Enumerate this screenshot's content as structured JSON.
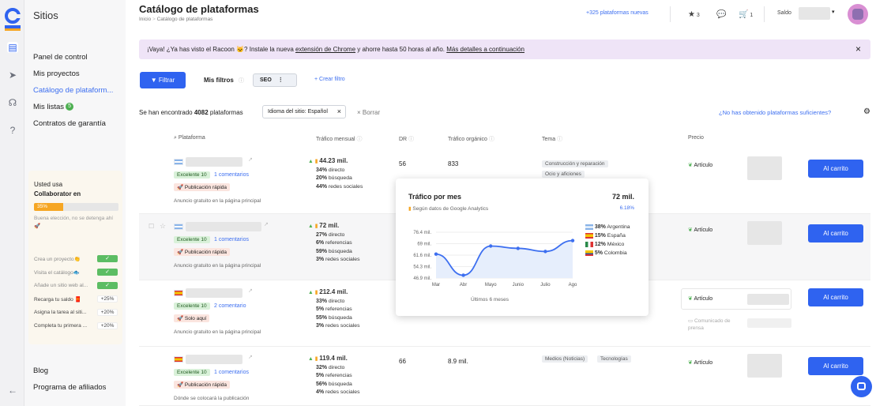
{
  "sidebar": {
    "title": "Sitios",
    "items": [
      "Panel de control",
      "Mis proyectos",
      "Catálogo de plataform...",
      "Mis listas",
      "Contratos de garantía"
    ],
    "lists_badge": "5",
    "footer": [
      "Blog",
      "Programa de afiliados"
    ]
  },
  "promo": {
    "line1": "Usted usa",
    "line2": "Collaborator en",
    "progress": "35%",
    "progress_value": 0.35,
    "note": "Buena elección, no se detenga ahí 🚀",
    "tasks": [
      {
        "label": "Crea un proyecto👏",
        "state": "✓",
        "done": true
      },
      {
        "label": "Visita el catálogo🐟",
        "state": "✓",
        "done": true
      },
      {
        "label": "Añade un sitio web al...",
        "state": "✓",
        "done": true
      },
      {
        "label": "Recarga tu saldo 🧧",
        "state": "+25%",
        "done": false
      },
      {
        "label": "Asigna la tarea al siti...",
        "state": "+20%",
        "done": false
      },
      {
        "label": "Completa tu primera ...",
        "state": "+20%",
        "done": false
      }
    ]
  },
  "header": {
    "title": "Catálogo de plataformas",
    "crumb_home": "Inicio",
    "crumb_sep": ">",
    "crumb_current": "Catálogo de plataformas",
    "new_platforms": "+325 plataformas nuevas",
    "favorites": "3",
    "cart_count": "1",
    "balance_label": "Saldo"
  },
  "banner": {
    "p1": "¡Vaya! ¿Ya has visto el Racoon 🐱? Instale la nueva ",
    "link1": "extensión de Chrome",
    "p2": " y ahorre hasta 50 horas al año. ",
    "link2": "Más detalles a continuación",
    "close": "×"
  },
  "filters": {
    "filter_btn": "Filtrar",
    "my_filters": "Mis filtros",
    "seo_chip": "SEO",
    "create": "+ Crear filtro",
    "found_pre": "Se han encontrado",
    "found_count": "4082",
    "found_post": "plataformas",
    "active_filter": "Idioma del sitio: Español",
    "clear": "Borrar",
    "not_enough": "¿No has obtenido plataformas suficientes?"
  },
  "columns": [
    "Plataforma",
    "Tráfico mensual",
    "DR",
    "Tráfico orgánico",
    "Tema",
    "Precio"
  ],
  "rows": [
    {
      "flag": "ar",
      "badge": "Excelente 10",
      "comments": "1 comentarios",
      "pub": "Publicación rápida",
      "note": "Anuncio gratuito en la página principal",
      "traffic": "44.23 mil.",
      "direct": "34%",
      "search": "20%",
      "social": "44%",
      "dr": "56",
      "organic": "833",
      "topics": [
        "Construcción y reparación",
        "Ocio y aficiones"
      ],
      "price": "Artículo",
      "cart": "Al carrito"
    },
    {
      "flag": "ar",
      "badge": "Excelente 10",
      "comments": "1 comentarios",
      "pub": "Publicación rápida",
      "note": "Anuncio gratuito en la página principal",
      "traffic": "72 mil.",
      "direct": "27%",
      "refs": "6%",
      "search": "59%",
      "social": "3%",
      "price": "Artículo",
      "cart": "Al carrito"
    },
    {
      "flag": "es",
      "badge": "Excelente 10",
      "comments": "2 comentario",
      "pub": "Solo aquí",
      "note": "Anuncio gratuito en la página principal",
      "traffic": "212.4 mil.",
      "direct": "33%",
      "refs": "5%",
      "search": "55%",
      "social": "3%",
      "price": "Artículo",
      "press": "Comunicado de prensa",
      "cart": "Al carrito"
    },
    {
      "flag": "es",
      "badge": "Excelente 10",
      "comments": "1 comentarios",
      "pub": "Publicación rápida",
      "note": "Dónde se colocará la publicación",
      "traffic": "119.4 mil.",
      "direct": "32%",
      "refs": "5%",
      "search": "56%",
      "social": "4%",
      "dr": "66",
      "organic": "8.9 mil.",
      "topics": [
        "Medios (Noticias)",
        "Tecnologías"
      ],
      "price": "Artículo",
      "cart": "Al carrito"
    }
  ],
  "labels": {
    "direct": "directo",
    "refs": "referencias",
    "search": "búsqueda",
    "social": "redes sociales"
  },
  "popup": {
    "title": "Tráfico por mes",
    "total": "72 mil.",
    "source": "Según datos de Google Analytics",
    "change": "6.18%",
    "footer": "Últimos 6 meses",
    "countries": [
      {
        "pct": "38%",
        "name": "Argentina"
      },
      {
        "pct": "15%",
        "name": "España"
      },
      {
        "pct": "12%",
        "name": "México"
      },
      {
        "pct": "5%",
        "name": "Colombia"
      }
    ]
  },
  "chart_data": {
    "type": "area",
    "categories": [
      "Mar",
      "Abr",
      "Mayo",
      "Junio",
      "Julio",
      "Ago"
    ],
    "values": [
      62.3,
      48.7,
      67.5,
      66.0,
      64.0,
      71.0
    ],
    "yticks": [
      "76.4 mil.",
      "69 mil.",
      "61.6 mil.",
      "54.3 mil.",
      "46.9 mil."
    ],
    "ylim": [
      46.9,
      76.4
    ],
    "xlabel": "Últimos 6 meses",
    "color": "#3d6ff0"
  }
}
